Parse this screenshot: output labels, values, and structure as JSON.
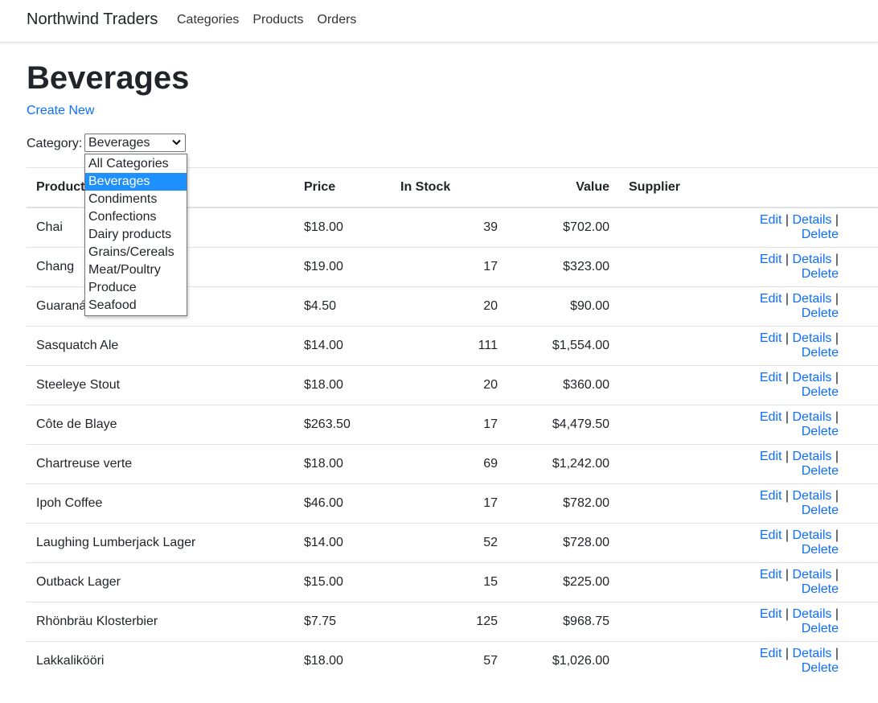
{
  "navbar": {
    "brand": "Northwind Traders",
    "links": [
      "Categories",
      "Products",
      "Orders"
    ]
  },
  "page": {
    "title": "Beverages",
    "create_new": "Create New"
  },
  "filter": {
    "label": "Category:",
    "selected": "Beverages",
    "options": [
      "All Categories",
      "Beverages",
      "Condiments",
      "Confections",
      "Dairy products",
      "Grains/Cereals",
      "Meat/Poultry",
      "Produce",
      "Seafood"
    ]
  },
  "table": {
    "headers": [
      "Product",
      "Price",
      "In Stock",
      "Value",
      "Supplier"
    ],
    "actions": {
      "edit": "Edit",
      "details": "Details",
      "delete": "Delete",
      "separator": "|"
    },
    "rows": [
      {
        "product": "Chai",
        "price": "$18.00",
        "stock": "39",
        "value": "$702.00",
        "supplier": ""
      },
      {
        "product": "Chang",
        "price": "$19.00",
        "stock": "17",
        "value": "$323.00",
        "supplier": ""
      },
      {
        "product": "Guaraná",
        "price": "$4.50",
        "stock": "20",
        "value": "$90.00",
        "supplier": ""
      },
      {
        "product": "Sasquatch Ale",
        "price": "$14.00",
        "stock": "111",
        "value": "$1,554.00",
        "supplier": ""
      },
      {
        "product": "Steeleye Stout",
        "price": "$18.00",
        "stock": "20",
        "value": "$360.00",
        "supplier": ""
      },
      {
        "product": "Côte de Blaye",
        "price": "$263.50",
        "stock": "17",
        "value": "$4,479.50",
        "supplier": ""
      },
      {
        "product": "Chartreuse verte",
        "price": "$18.00",
        "stock": "69",
        "value": "$1,242.00",
        "supplier": ""
      },
      {
        "product": "Ipoh Coffee",
        "price": "$46.00",
        "stock": "17",
        "value": "$782.00",
        "supplier": ""
      },
      {
        "product": "Laughing Lumberjack Lager",
        "price": "$14.00",
        "stock": "52",
        "value": "$728.00",
        "supplier": ""
      },
      {
        "product": "Outback Lager",
        "price": "$15.00",
        "stock": "15",
        "value": "$225.00",
        "supplier": ""
      },
      {
        "product": "Rhönbräu Klosterbier",
        "price": "$7.75",
        "stock": "125",
        "value": "$968.75",
        "supplier": ""
      },
      {
        "product": "Lakkalikööri",
        "price": "$18.00",
        "stock": "57",
        "value": "$1,026.00",
        "supplier": ""
      }
    ]
  },
  "colors": {
    "link": "#0d6efd",
    "selected_option": "#1e90ff",
    "border": "#dee2e6"
  }
}
